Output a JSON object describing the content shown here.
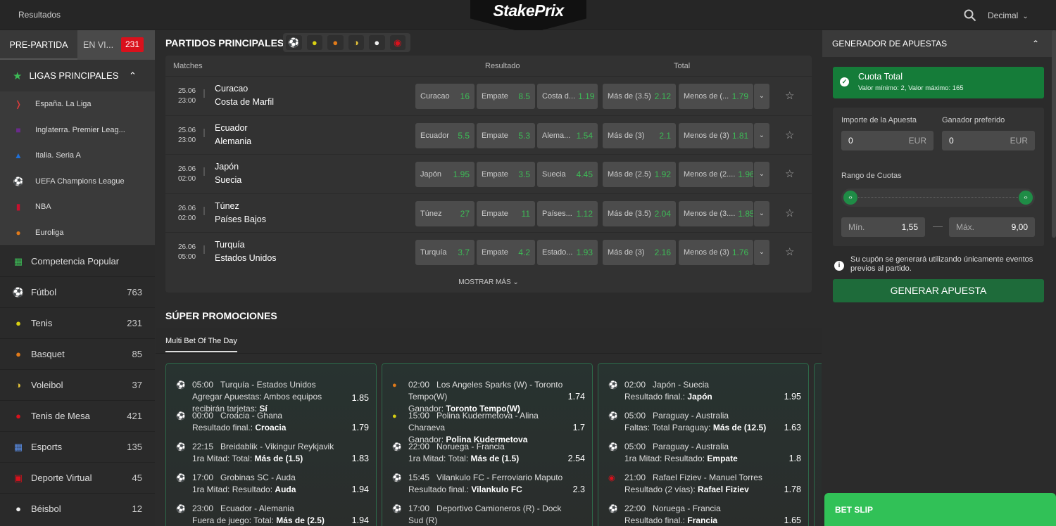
{
  "header": {
    "results": "Resultados",
    "logo": "StakePrix",
    "odds_format": "Decimal"
  },
  "sidebar": {
    "tab_pre": "PRE-PARTIDA",
    "tab_live": "EN VI...",
    "live_count": "231",
    "leagues_title": "LIGAS PRINCIPALES",
    "leagues": [
      {
        "name": "España. La Liga",
        "icon": "laliga-icon"
      },
      {
        "name": "Inglaterra. Premier Leag...",
        "icon": "premier-league-icon"
      },
      {
        "name": "Italia. Seria A",
        "icon": "serie-a-icon"
      },
      {
        "name": "UEFA Champions League",
        "icon": "soccer-ball-icon"
      },
      {
        "name": "NBA",
        "icon": "nba-icon"
      },
      {
        "name": "Euroliga",
        "icon": "basketball-icon"
      }
    ],
    "sports": [
      {
        "name": "Competencia Popular",
        "count": "",
        "icon": "podium-icon"
      },
      {
        "name": "Fútbol",
        "count": "763",
        "icon": "soccer-ball-icon"
      },
      {
        "name": "Tenis",
        "count": "231",
        "icon": "tennis-ball-icon"
      },
      {
        "name": "Basquet",
        "count": "85",
        "icon": "basketball-icon"
      },
      {
        "name": "Voleibol",
        "count": "37",
        "icon": "volleyball-icon"
      },
      {
        "name": "Tenis de Mesa",
        "count": "421",
        "icon": "table-tennis-icon"
      },
      {
        "name": "Esports",
        "count": "135",
        "icon": "gamepad-icon"
      },
      {
        "name": "Deporte Virtual",
        "count": "45",
        "icon": "virtual-sport-icon"
      },
      {
        "name": "Béisbol",
        "count": "12",
        "icon": "baseball-icon"
      }
    ]
  },
  "main": {
    "title": "PARTIDOS PRINCIPALES",
    "sport_filters": [
      "soccer-ball-icon",
      "tennis-ball-icon",
      "basketball-icon",
      "volleyball-icon",
      "baseball-icon",
      "ufc-icon"
    ],
    "col_matches": "Matches",
    "col_result": "Resultado",
    "col_total": "Total",
    "matches": [
      {
        "date": "25.06",
        "time": "23:00",
        "home": "Curacao",
        "away": "Costa de Marfil",
        "o1": [
          "Curacao",
          "16"
        ],
        "ox": [
          "Empate",
          "8.5"
        ],
        "o2": [
          "Costa d...",
          "1.19"
        ],
        "over": [
          "Más de (3.5)",
          "2.12"
        ],
        "under": [
          "Menos de (...",
          "1.79"
        ]
      },
      {
        "date": "25.06",
        "time": "23:00",
        "home": "Ecuador",
        "away": "Alemania",
        "o1": [
          "Ecuador",
          "5.5"
        ],
        "ox": [
          "Empate",
          "5.3"
        ],
        "o2": [
          "Alema...",
          "1.54"
        ],
        "over": [
          "Más de (3)",
          "2.1"
        ],
        "under": [
          "Menos de (3)",
          "1.81"
        ]
      },
      {
        "date": "26.06",
        "time": "02:00",
        "home": "Japón",
        "away": "Suecia",
        "o1": [
          "Japón",
          "1.95"
        ],
        "ox": [
          "Empate",
          "3.5"
        ],
        "o2": [
          "Suecia",
          "4.45"
        ],
        "over": [
          "Más de (2.5)",
          "1.92"
        ],
        "under": [
          "Menos de (2....",
          "1.96"
        ]
      },
      {
        "date": "26.06",
        "time": "02:00",
        "home": "Túnez",
        "away": "Países Bajos",
        "o1": [
          "Túnez",
          "27"
        ],
        "ox": [
          "Empate",
          "11"
        ],
        "o2": [
          "Países...",
          "1.12"
        ],
        "over": [
          "Más de (3.5)",
          "2.04"
        ],
        "under": [
          "Menos de (3....",
          "1.85"
        ]
      },
      {
        "date": "26.06",
        "time": "05:00",
        "home": "Turquía",
        "away": "Estados Unidos",
        "o1": [
          "Turquía",
          "3.7"
        ],
        "ox": [
          "Empate",
          "4.2"
        ],
        "o2": [
          "Estado...",
          "1.93"
        ],
        "over": [
          "Más de (3)",
          "2.16"
        ],
        "under": [
          "Menos de (3)",
          "1.76"
        ]
      }
    ],
    "show_more": "MOSTRAR MÁS",
    "promos_title": "SÚPER PROMOCIONES",
    "promo_tab": "Multi Bet Of The Day",
    "cards": [
      [
        {
          "icon": "soccer-ball-icon",
          "time": "05:00",
          "match": "Turquía - Estados Unidos",
          "market": "Agregar Apuestas: Ambos equipos recibirán tarjetas: ",
          "pick": "Sí",
          "odd": "1.85"
        },
        {
          "icon": "soccer-ball-icon",
          "time": "00:00",
          "match": "Croacia - Ghana",
          "market": "Resultado final.: ",
          "pick": "Croacia",
          "odd": "1.79"
        },
        {
          "icon": "soccer-ball-icon",
          "time": "22:15",
          "match": "Breidablik - Vikingur Reykjavik",
          "market": "1ra Mitad: Total: ",
          "pick": "Más de (1.5)",
          "odd": "1.83"
        },
        {
          "icon": "soccer-ball-icon",
          "time": "17:00",
          "match": "Grobinas SC - Auda",
          "market": "1ra Mitad: Resultado: ",
          "pick": "Auda",
          "odd": "1.94"
        },
        {
          "icon": "soccer-ball-icon",
          "time": "23:00",
          "match": "Ecuador - Alemania",
          "market": "Fuera de juego: Total: ",
          "pick": "Más de (2.5)",
          "odd": "1.94"
        }
      ],
      [
        {
          "icon": "basketball-icon",
          "time": "02:00",
          "match": "Los Angeles Sparks (W) - Toronto Tempo(W)",
          "market": "Ganador: ",
          "pick": "Toronto Tempo(W)",
          "odd": "1.74"
        },
        {
          "icon": "tennis-ball-icon",
          "time": "15:00",
          "match": "Polina Kudermetova - Alina Charaeva",
          "market": "Ganador: ",
          "pick": "Polina Kudermetova",
          "odd": "1.7"
        },
        {
          "icon": "soccer-ball-icon",
          "time": "22:00",
          "match": "Noruega - Francia",
          "market": "1ra Mitad: Total: ",
          "pick": "Más de (1.5)",
          "odd": "2.54"
        },
        {
          "icon": "soccer-ball-icon",
          "time": "15:45",
          "match": "Vilankulo FC - Ferroviario Maputo",
          "market": "Resultado final.: ",
          "pick": "Vilankulo FC",
          "odd": "2.3"
        },
        {
          "icon": "soccer-ball-icon",
          "time": "17:00",
          "match": "Deportivo Camioneros (R) - Dock Sud (R)",
          "market": "",
          "pick": "",
          "odd": ""
        }
      ],
      [
        {
          "icon": "soccer-ball-icon",
          "time": "02:00",
          "match": "Japón - Suecia",
          "market": "Resultado final.: ",
          "pick": "Japón",
          "odd": "1.95"
        },
        {
          "icon": "soccer-ball-icon",
          "time": "05:00",
          "match": "Paraguay - Australia",
          "market": "Faltas: Total Paraguay: ",
          "pick": "Más de (12.5)",
          "odd": "1.63"
        },
        {
          "icon": "soccer-ball-icon",
          "time": "05:00",
          "match": "Paraguay - Australia",
          "market": "1ra Mitad: Resultado: ",
          "pick": "Empate",
          "odd": "1.8"
        },
        {
          "icon": "ufc-icon",
          "time": "21:00",
          "match": "Rafael Fiziev - Manuel Torres",
          "market": "Resultado (2 vías): ",
          "pick": "Rafael Fiziev",
          "odd": "1.78"
        },
        {
          "icon": "soccer-ball-icon",
          "time": "22:00",
          "match": "Noruega - Francia",
          "market": "Resultado final.: ",
          "pick": "Francia",
          "odd": "1.65"
        }
      ]
    ]
  },
  "generator": {
    "title": "GENERADOR DE APUESTAS",
    "total_title": "Cuota Total",
    "total_sub": "Valor mínimo: 2, Valor máximo: 165",
    "stake_label": "Importe de la Apuesta",
    "stake_value": "0",
    "stake_cur": "EUR",
    "win_label": "Ganador preferido",
    "win_value": "0",
    "win_cur": "EUR",
    "range_label": "Rango de Cuotas",
    "min_label": "Mín.",
    "min_value": "1,55",
    "max_label": "Máx.",
    "max_value": "9,00",
    "info": "Su cupón se generará utilizando únicamente eventos previos al partido.",
    "button": "GENERAR APUESTA"
  },
  "betslip": "BET SLIP",
  "colors": {
    "accent_green": "#3dbb56",
    "live_red": "#d9111c",
    "betslip_green": "#31c157"
  }
}
